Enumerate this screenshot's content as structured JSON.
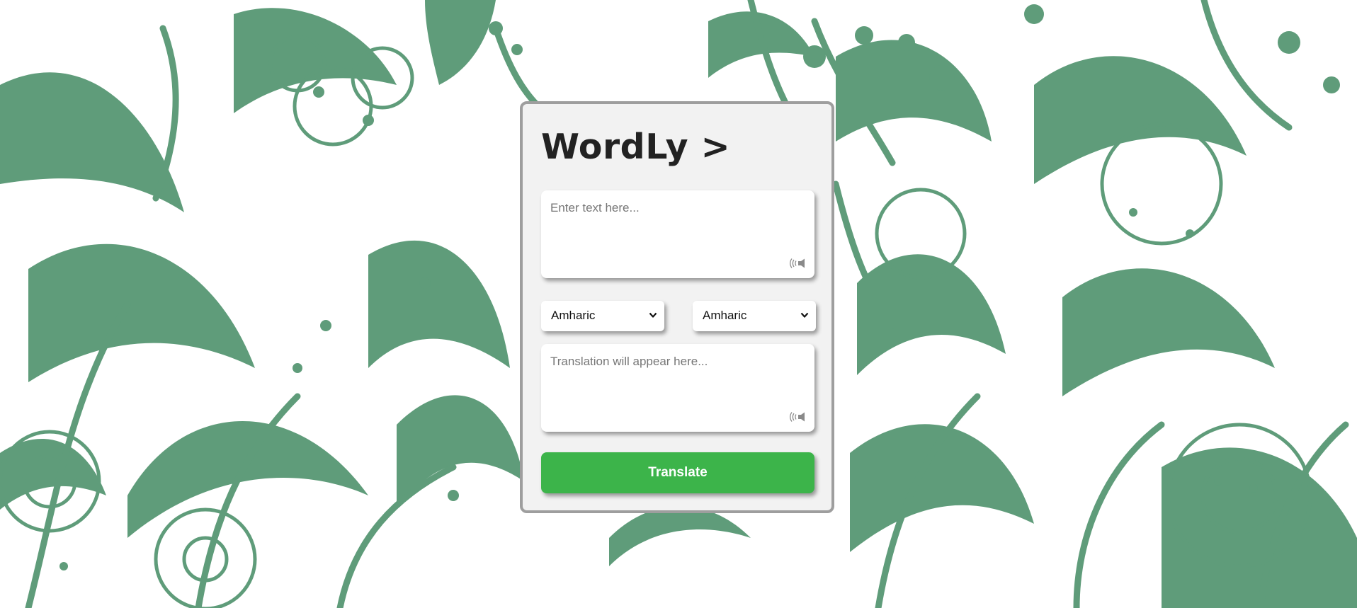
{
  "app": {
    "title": "WordLy >"
  },
  "input": {
    "placeholder": "Enter text here...",
    "value": "",
    "speak_icon": "speaker-icon"
  },
  "languages": {
    "source_selected": "Amharic",
    "target_selected": "Amharic",
    "dropdown_icon": "chevron-down-icon"
  },
  "output": {
    "placeholder": "Translation will appear here...",
    "value": "",
    "speak_icon": "speaker-icon"
  },
  "actions": {
    "translate_label": "Translate"
  },
  "colors": {
    "background_pattern": "#5f9c7a",
    "card_background": "#f2f2f2",
    "card_border": "#9e9e9e",
    "button_green": "#3cb44a",
    "title_text": "#222222"
  }
}
